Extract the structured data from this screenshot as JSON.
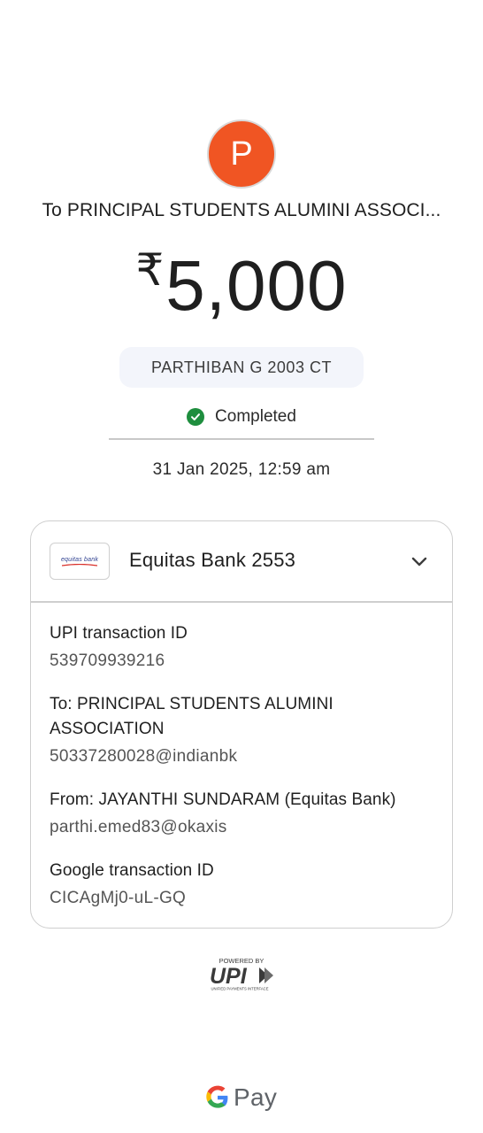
{
  "payee": {
    "avatar_letter": "P",
    "avatar_color": "#f05523",
    "title": "To PRINCIPAL STUDENTS ALUMINI ASSOCI..."
  },
  "payment": {
    "currency_symbol": "₹",
    "amount": "5,000",
    "note": "PARTHIBAN G 2003 CT",
    "status": "Completed",
    "status_icon": "check-circle-icon",
    "status_color": "#1e8e3e",
    "datetime": "31 Jan 2025, 12:59 am"
  },
  "card": {
    "bank_logo_text": "equitas bank",
    "bank_name": "Equitas Bank 2553",
    "expand_icon": "chevron-down-icon",
    "details": [
      {
        "label": "UPI transaction ID",
        "value": "539709939216"
      },
      {
        "label": "To: PRINCIPAL STUDENTS ALUMINI ASSOCIATION",
        "value": "50337280028@indianbk"
      },
      {
        "label": "From: JAYANTHI SUNDARAM (Equitas Bank)",
        "value": "parthi.emed83@okaxis"
      },
      {
        "label": "Google transaction ID",
        "value": "CICAgMj0-uL-GQ"
      }
    ]
  },
  "footer": {
    "upi_powered_by": "POWERED BY",
    "upi_wordmark": "UPI",
    "upi_tagline": "UNIFIED PAYMENTS INTERFACE",
    "gpay_label": "Pay"
  }
}
